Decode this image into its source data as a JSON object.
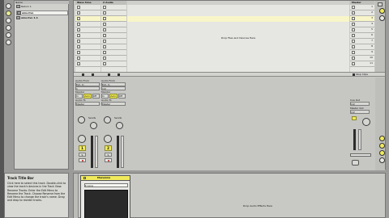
{
  "browser": {
    "header": "Name",
    "items": [
      {
        "label": "Return 1"
      },
      {
        "label": "ame.live"
      },
      {
        "label": "ame.live 1-1"
      }
    ]
  },
  "session": {
    "track1_title": "Wavs time",
    "track2_title": "2 Audio",
    "master_title": "Master",
    "drop_zone_text": "Drop Files and Devices Here",
    "master_scenes": [
      "1",
      "2",
      "3",
      "4",
      "5",
      "6",
      "7",
      "8",
      "9",
      "10",
      "11",
      "12"
    ],
    "stop_clips": "Stop Clips"
  },
  "mixer": {
    "audio_from_label": "Audio From",
    "ext_in": "Ext. In",
    "ch_in_1": "1",
    "ch_in_2": "1/2",
    "monitor_label": "Monitor",
    "monitor_in": "In",
    "monitor_auto": "Auto",
    "monitor_off": "Off",
    "audio_to_label": "Audio To",
    "audio_to_value": "Master",
    "sends_label": "Sends",
    "track1_number": "1",
    "track2_number": "2",
    "solo": "S",
    "cue_out_label": "Cue Out",
    "cue_out_value": "1/2",
    "master_out_label": "Master Out",
    "master_out_value": "1/2"
  },
  "info": {
    "title": "Track Title Bar",
    "text": "Click here to select this track. Double-click to view the track's devices in the Track View. Rename Tracks: Enter the Edit Menu to Rename the Track. Choose Rename from the Edit Menu to change the track's name. Drag and drop to reorder tracks."
  },
  "track_view": {
    "device_title": "Mazumna",
    "drop_text": "Drop Audio Effects Here",
    "device_dropdown": "none"
  },
  "colors": {
    "accent_yellow": "#f0ea5c",
    "clip_highlight": "#f8f6c8",
    "device_bg": "#2a2a2a"
  }
}
